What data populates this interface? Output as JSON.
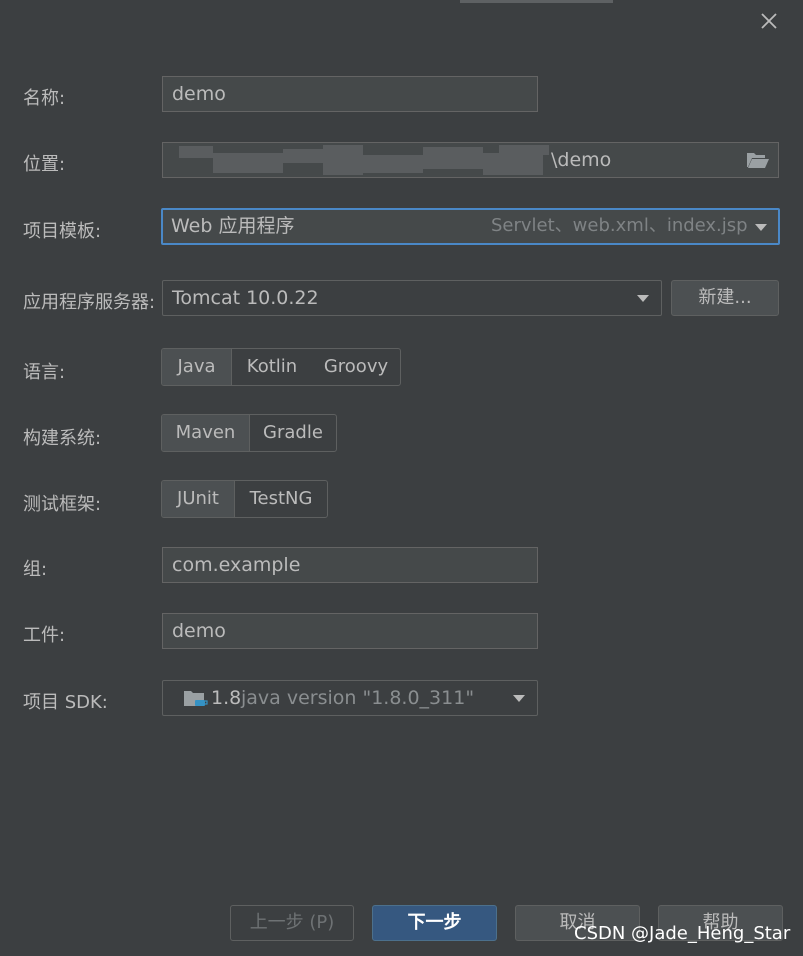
{
  "dialog": {
    "close_icon": "close-icon"
  },
  "form": {
    "name": {
      "label": "名称:",
      "value": "demo"
    },
    "location": {
      "label": "位置:",
      "value": "\\demo",
      "icon": "folder-open-icon"
    },
    "template": {
      "label": "项目模板:",
      "value": "Web 应用程序",
      "hint": "Servlet、web.xml、index.jsp"
    },
    "server": {
      "label": "应用程序服务器:",
      "value": "Tomcat 10.0.22",
      "new_button": "新建..."
    },
    "language": {
      "label": "语言:",
      "options": [
        "Java",
        "Kotlin",
        "Groovy"
      ],
      "selected": "Java"
    },
    "build_system": {
      "label": "构建系统:",
      "options": [
        "Maven",
        "Gradle"
      ],
      "selected": "Maven"
    },
    "test_framework": {
      "label": "测试框架:",
      "options": [
        "JUnit",
        "TestNG"
      ],
      "selected": "JUnit"
    },
    "group": {
      "label": "组:",
      "value": "com.example"
    },
    "artifact": {
      "label": "工件:",
      "value": "demo"
    },
    "sdk": {
      "label": "项目 SDK:",
      "version": "1.8",
      "detail": "java version \"1.8.0_311\"",
      "icon": "jdk-folder-icon"
    }
  },
  "footer": {
    "prev": "上一步 (P)",
    "next": "下一步",
    "cancel": "取消",
    "help": "帮助"
  },
  "watermark": "CSDN @Jade_Heng_Star",
  "colors": {
    "background": "#3c3f41",
    "accent": "#4a88c7",
    "primary_button": "#365880"
  }
}
